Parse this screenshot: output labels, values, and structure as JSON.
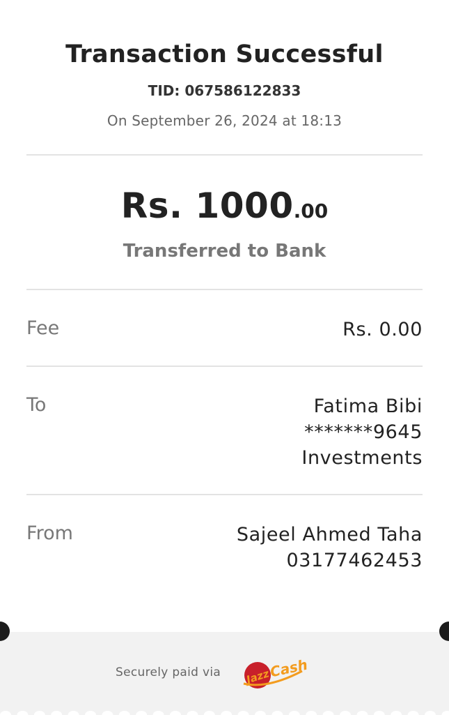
{
  "header": {
    "title": "Transaction Successful",
    "tid": "TID: 067586122833",
    "datetime": "On September 26, 2024 at 18:13"
  },
  "amount": {
    "main": "Rs. 1000",
    "cents": ".00",
    "description": "Transferred to Bank"
  },
  "details": {
    "fee": {
      "label": "Fee",
      "value": "Rs. 0.00"
    },
    "to": {
      "label": "To",
      "name": "Fatima Bibi",
      "account": "*******9645",
      "bank": "Investments"
    },
    "from": {
      "label": "From",
      "name": "Sajeel Ahmed Taha",
      "number": "03177462453"
    }
  },
  "footer": {
    "secure_text": "Securely paid via",
    "logo_icon": "jazzcash-logo",
    "logo_text_1": "Jazz",
    "logo_text_2": "Cash"
  },
  "colors": {
    "title": "#222222",
    "muted": "#777777",
    "divider": "#e3e3e3",
    "footer_bg": "#f2f2f2",
    "logo_red": "#c8202b",
    "logo_orange": "#f39c1f"
  }
}
